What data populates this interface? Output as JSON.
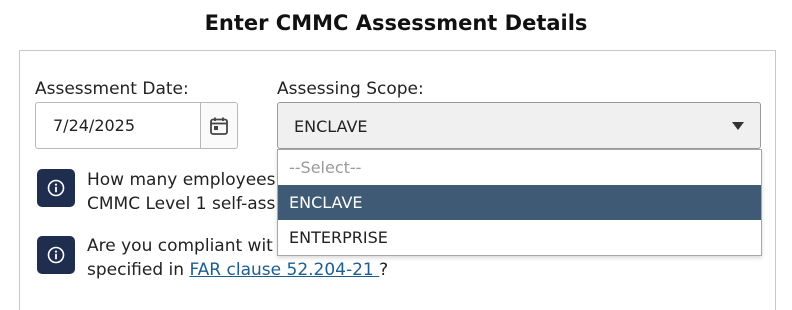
{
  "page": {
    "title": "Enter CMMC Assessment Details"
  },
  "form": {
    "assessment_date": {
      "label": "Assessment Date:",
      "value": "7/24/2025",
      "icon": "calendar-icon"
    },
    "assessing_scope": {
      "label": "Assessing Scope:",
      "selected": "ENCLAVE",
      "options": [
        "--Select--",
        "ENCLAVE",
        "ENTERPRISE"
      ],
      "highlighted_index": 1
    }
  },
  "questions": [
    {
      "icon": "info-icon",
      "line1": "How many employees",
      "line2": "CMMC Level 1 self-ass"
    },
    {
      "icon": "info-icon",
      "line1": "Are you compliant wit",
      "line2_prefix": "specified in ",
      "link_text": "FAR clause 52.204-21 ",
      "line2_suffix": "?"
    }
  ],
  "colors": {
    "selected_option_bg": "#3e5a74",
    "info_icon_bg": "#1f2d4f",
    "link": "#1b5e8f"
  }
}
